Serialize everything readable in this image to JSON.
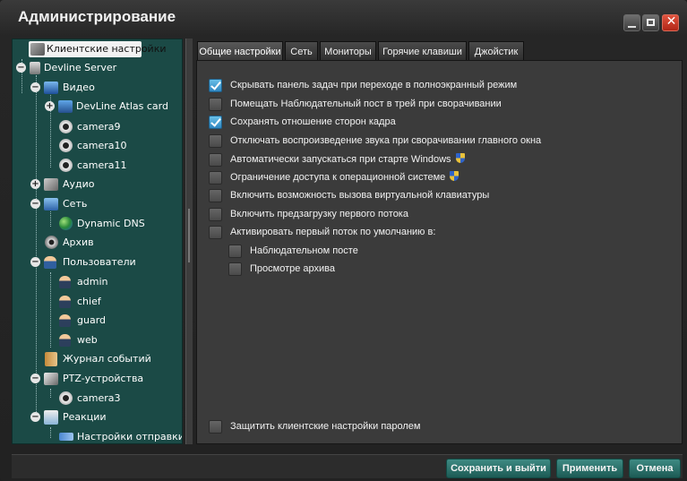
{
  "window": {
    "title": "Администрирование"
  },
  "tree": {
    "root": "Клиентские настройки",
    "server": "Devline Server",
    "video": "Видео",
    "card": "DevLine Atlas card",
    "cameras": [
      "camera9",
      "camera10",
      "camera11"
    ],
    "audio": "Аудио",
    "network": "Сеть",
    "ddns": "Dynamic DNS",
    "archive": "Архив",
    "users": "Пользователи",
    "user_list": [
      "admin",
      "chief",
      "guard",
      "web"
    ],
    "journal": "Журнал событий",
    "ptz": "PTZ-устройства",
    "ptz_camera": "camera3",
    "reactions": "Реакции",
    "send_settings": "Настройки отправки"
  },
  "tabs": [
    {
      "label": "Общие настройки",
      "active": true
    },
    {
      "label": "Сеть",
      "active": false
    },
    {
      "label": "Мониторы",
      "active": false
    },
    {
      "label": "Горячие клавиши",
      "active": false
    },
    {
      "label": "Джойстик",
      "active": false
    }
  ],
  "options": [
    {
      "label": "Скрывать панель задач при переходе в полноэкранный режим",
      "checked": true
    },
    {
      "label": "Помещать Наблюдательный пост в трей при сворачивании",
      "checked": false
    },
    {
      "label": "Сохранять отношение сторон кадра",
      "checked": true
    },
    {
      "label": "Отключать воспроизведение звука при сворачивании главного окна",
      "checked": false
    },
    {
      "label": "Автоматически запускаться при старте Windows",
      "checked": false,
      "shield_icon": true
    },
    {
      "label": "Ограничение доступа к операционной системе",
      "checked": false,
      "shield_icon": true
    },
    {
      "label": "Включить возможность вызова виртуальной клавиатуры",
      "checked": false
    },
    {
      "label": "Включить предзагрузку первого потока",
      "checked": false
    },
    {
      "label": "Активировать первый поток по умолчанию в:",
      "checked": false
    }
  ],
  "sub_options": [
    {
      "label": "Наблюдательном посте",
      "checked": false
    },
    {
      "label": "Просмотре архива",
      "checked": false
    }
  ],
  "password_option": {
    "label": "Защитить клиентские настройки паролем",
    "checked": false
  },
  "buttons": {
    "save_exit": "Сохранить и выйти",
    "apply": "Применить",
    "cancel": "Отмена"
  },
  "colors": {
    "tree_bg": "#1b4a46",
    "button_bg": "#2b726b",
    "checkbox_on": "#3a9bd5"
  }
}
